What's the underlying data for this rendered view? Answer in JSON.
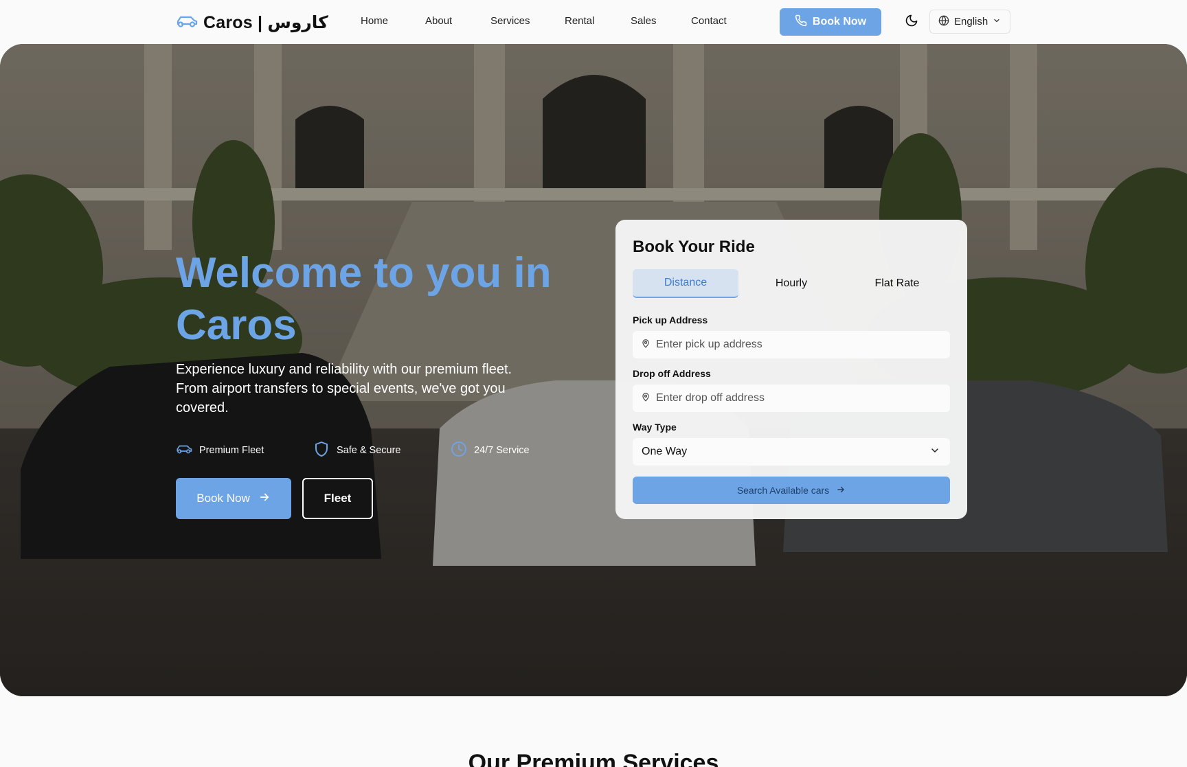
{
  "header": {
    "logo_text": "Caros | كاروس",
    "nav": [
      "Home",
      "About",
      "Services",
      "Rental",
      "Sales",
      "Contact"
    ],
    "book_label": "Book Now",
    "language": "English"
  },
  "hero": {
    "title": "Welcome to you in Caros",
    "subtitle": "Experience luxury and reliability with our premium fleet. From airport transfers to special events, we've got you covered.",
    "features": [
      "Premium Fleet",
      "Safe & Secure",
      "24/7 Service"
    ],
    "book_label": "Book Now",
    "fleet_label": "Fleet"
  },
  "booking": {
    "title": "Book Your Ride",
    "tabs": [
      "Distance",
      "Hourly",
      "Flat Rate"
    ],
    "active_tab": "Distance",
    "pickup_label": "Pick up Address",
    "pickup_placeholder": "Enter pick up address",
    "dropoff_label": "Drop off Address",
    "dropoff_placeholder": "Enter drop off address",
    "way_label": "Way Type",
    "way_value": "One Way",
    "search_label": "Search Available cars"
  },
  "services_title": "Our Premium Services",
  "colors": {
    "accent": "#6ca4e6",
    "tab_active_bg": "#d6e2f0"
  }
}
